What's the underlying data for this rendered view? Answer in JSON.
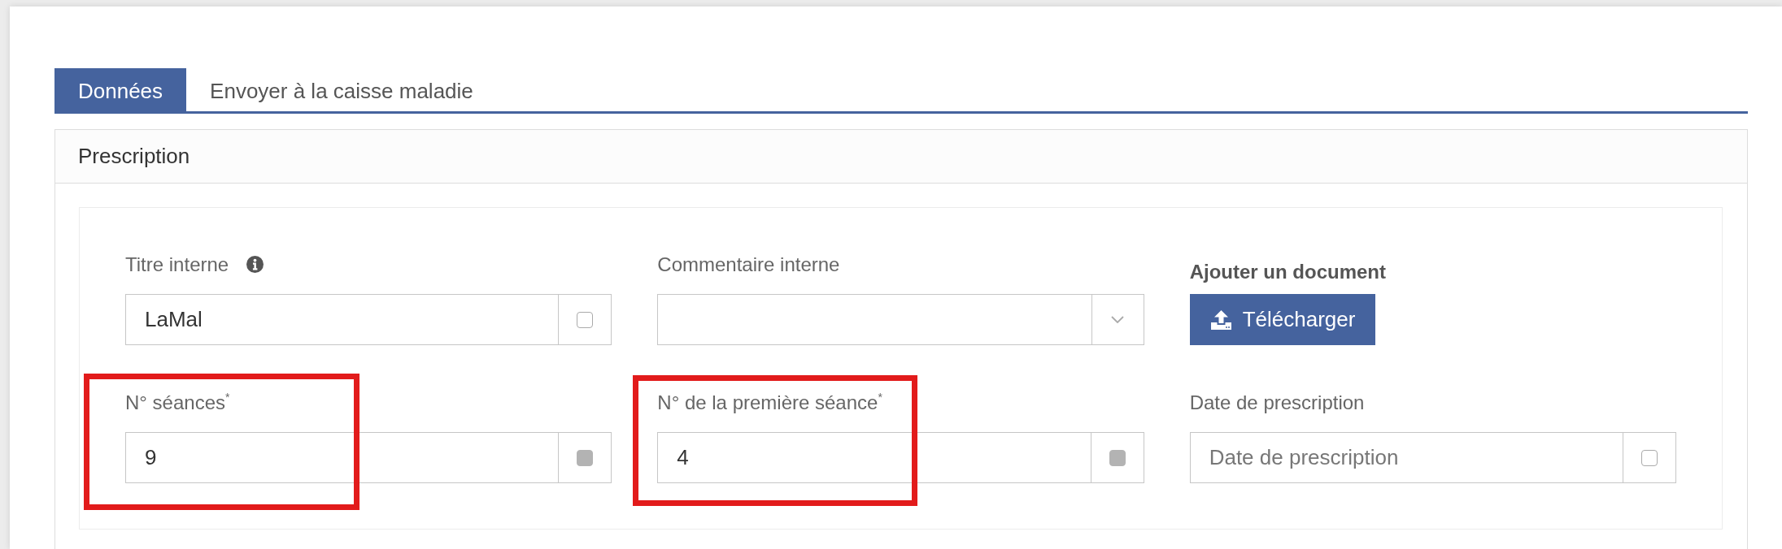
{
  "tabs": [
    {
      "label": "Données",
      "selected": true
    },
    {
      "label": "Envoyer à la caisse maladie",
      "selected": false
    }
  ],
  "panel": {
    "title": "Prescription",
    "fields": [
      {
        "kind": "input",
        "label": "Titre interne",
        "info": true,
        "value": "LaMal",
        "checkbox_disabled": false,
        "highlighted": false
      },
      {
        "kind": "select",
        "label": "Commentaire interne",
        "info": false,
        "highlighted": false
      },
      {
        "kind": "upload",
        "label": "Ajouter un document",
        "button": "Télécharger",
        "info": false,
        "highlighted": false
      },
      {
        "kind": "input",
        "label": "N° séances$^{*}$",
        "info": false,
        "value": "9",
        "checkbox_disabled": true,
        "highlighted": true
      },
      {
        "kind": "input",
        "label": "N° de la première séance$^{*}$",
        "info": false,
        "value": "4",
        "checkbox_disabled": true,
        "highlighted": true
      },
      {
        "kind": "input",
        "label": "Date de prescription",
        "info": false,
        "placeholder": "Date de prescription",
        "checkbox_disabled": false,
        "highlighted": false
      }
    ]
  }
}
